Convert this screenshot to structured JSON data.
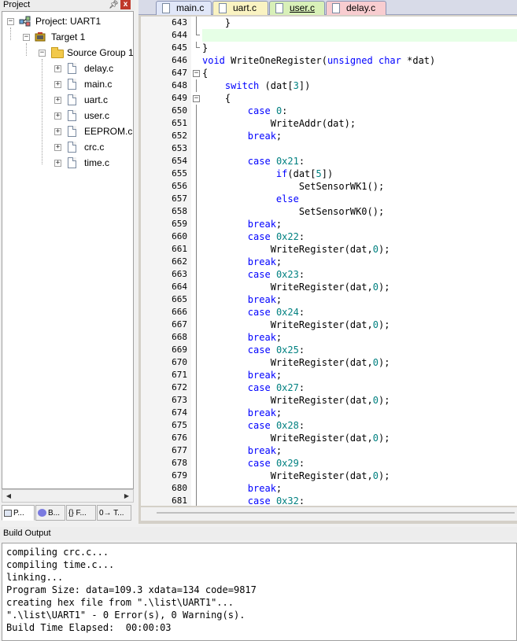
{
  "project_panel": {
    "title": "Project",
    "pin": "ᵖ",
    "close": "x",
    "tree": {
      "project": "Project: UART1",
      "target": "Target 1",
      "group": "Source Group 1",
      "files": [
        "delay.c",
        "main.c",
        "uart.c",
        "user.c",
        "EEPROM.c",
        "crc.c",
        "time.c"
      ]
    },
    "tabs": [
      "P...",
      "B...",
      "{} F...",
      "0→ T..."
    ]
  },
  "editor": {
    "tabs": [
      {
        "label": "main.c",
        "color": "#e1e7f8"
      },
      {
        "label": "uart.c",
        "color": "#faf3c2"
      },
      {
        "label": "user.c",
        "color": "#d8f0b8",
        "active": true
      },
      {
        "label": "delay.c",
        "color": "#f8cdd0"
      }
    ],
    "lines": [
      {
        "no": "643",
        "html": "    }"
      },
      {
        "no": "644",
        "html": ""
      },
      {
        "no": "645",
        "html": "}"
      },
      {
        "no": "646",
        "html": "<span class=\"kw\">void</span> WriteOneRegister(<span class=\"kw\">unsigned</span> <span class=\"kw\">char</span> *dat)"
      },
      {
        "no": "647",
        "html": "{"
      },
      {
        "no": "648",
        "html": "    <span class=\"kw\">switch</span> (dat[<span class=\"num\">3</span>])"
      },
      {
        "no": "649",
        "html": "    {"
      },
      {
        "no": "650",
        "html": "        <span class=\"kw\">case</span> <span class=\"num\">0</span>:"
      },
      {
        "no": "651",
        "html": "            WriteAddr(dat);"
      },
      {
        "no": "652",
        "html": "        <span class=\"kw\">break</span>;"
      },
      {
        "no": "653",
        "html": ""
      },
      {
        "no": "654",
        "html": "        <span class=\"kw\">case</span> <span class=\"num\">0x21</span>:"
      },
      {
        "no": "655",
        "html": "             <span class=\"kw\">if</span>(dat[<span class=\"num\">5</span>])"
      },
      {
        "no": "656",
        "html": "                 SetSensorWK1();"
      },
      {
        "no": "657",
        "html": "             <span class=\"kw\">else</span>"
      },
      {
        "no": "658",
        "html": "                 SetSensorWK0();"
      },
      {
        "no": "659",
        "html": "        <span class=\"kw\">break</span>;"
      },
      {
        "no": "660",
        "html": "        <span class=\"kw\">case</span> <span class=\"num\">0x22</span>:"
      },
      {
        "no": "661",
        "html": "            WriteRegister(dat,<span class=\"num\">0</span>);"
      },
      {
        "no": "662",
        "html": "        <span class=\"kw\">break</span>;"
      },
      {
        "no": "663",
        "html": "        <span class=\"kw\">case</span> <span class=\"num\">0x23</span>:"
      },
      {
        "no": "664",
        "html": "            WriteRegister(dat,<span class=\"num\">0</span>);"
      },
      {
        "no": "665",
        "html": "        <span class=\"kw\">break</span>;"
      },
      {
        "no": "666",
        "html": "        <span class=\"kw\">case</span> <span class=\"num\">0x24</span>:"
      },
      {
        "no": "667",
        "html": "            WriteRegister(dat,<span class=\"num\">0</span>);"
      },
      {
        "no": "668",
        "html": "        <span class=\"kw\">break</span>;"
      },
      {
        "no": "669",
        "html": "        <span class=\"kw\">case</span> <span class=\"num\">0x25</span>:"
      },
      {
        "no": "670",
        "html": "            WriteRegister(dat,<span class=\"num\">0</span>);"
      },
      {
        "no": "671",
        "html": "        <span class=\"kw\">break</span>;"
      },
      {
        "no": "672",
        "html": "        <span class=\"kw\">case</span> <span class=\"num\">0x27</span>:"
      },
      {
        "no": "673",
        "html": "            WriteRegister(dat,<span class=\"num\">0</span>);"
      },
      {
        "no": "674",
        "html": "        <span class=\"kw\">break</span>;"
      },
      {
        "no": "675",
        "html": "        <span class=\"kw\">case</span> <span class=\"num\">0x28</span>:"
      },
      {
        "no": "676",
        "html": "            WriteRegister(dat,<span class=\"num\">0</span>);"
      },
      {
        "no": "677",
        "html": "        <span class=\"kw\">break</span>;"
      },
      {
        "no": "678",
        "html": "        <span class=\"kw\">case</span> <span class=\"num\">0x29</span>:"
      },
      {
        "no": "679",
        "html": "            WriteRegister(dat,<span class=\"num\">0</span>);"
      },
      {
        "no": "680",
        "html": "        <span class=\"kw\">break</span>;"
      },
      {
        "no": "681",
        "html": "        <span class=\"kw\">case</span> <span class=\"num\">0x32</span>:"
      }
    ]
  },
  "build_output": {
    "title": "Build Output",
    "lines": [
      "compiling crc.c...",
      "compiling time.c...",
      "linking...",
      "Program Size: data=109.3 xdata=134 code=9817",
      "creating hex file from \".\\list\\UART1\"...",
      "\".\\list\\UART1\" - 0 Error(s), 0 Warning(s).",
      "Build Time Elapsed:  00:00:03"
    ]
  }
}
